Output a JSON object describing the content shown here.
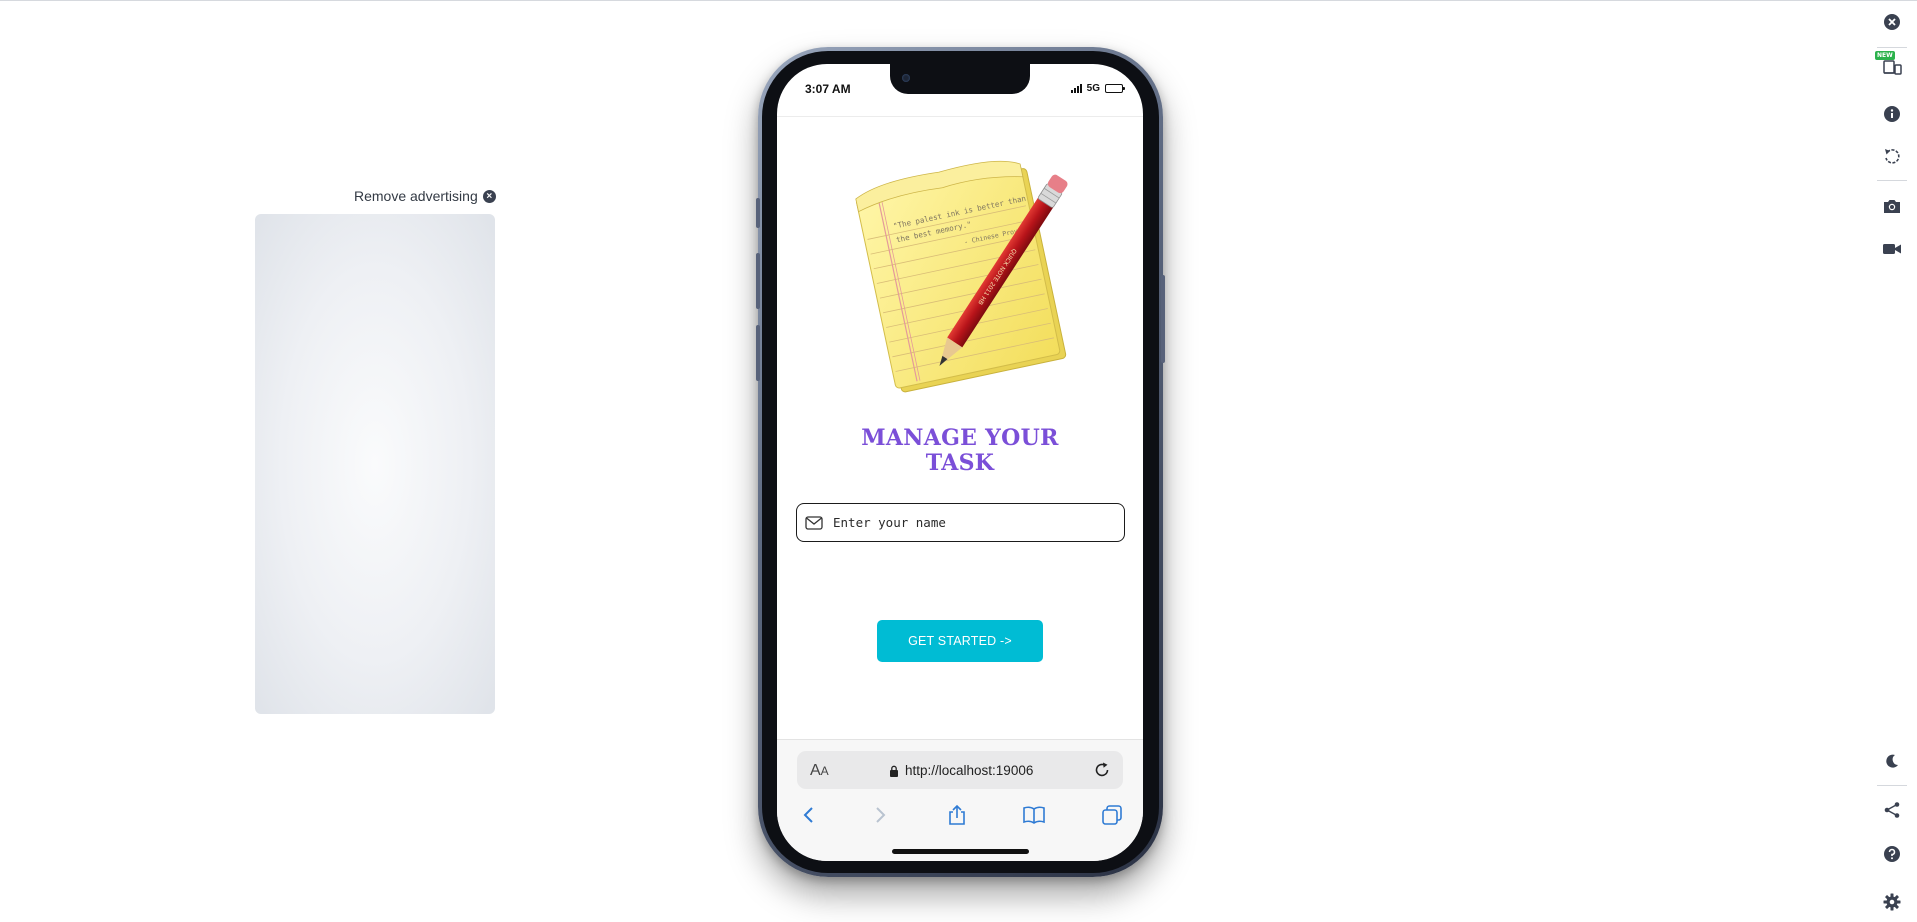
{
  "ad": {
    "remove_label": "Remove advertising"
  },
  "phone": {
    "status": {
      "time": "3:07 AM",
      "network": "5G"
    },
    "app": {
      "title_line1": "MANAGE YOUR",
      "title_line2": "TASK",
      "name_placeholder": "Enter your name",
      "name_value": "",
      "cta_label": "GET STARTED ->",
      "notepad_quote_line1": "\"The palest ink is better than",
      "notepad_quote_line2": "the best memory.\"",
      "notepad_quote_author": "- Chinese Proverb",
      "pencil_text": "QUICK NOTE 2011 HB"
    },
    "browser": {
      "text_size_label": "AA",
      "url": "http://localhost:19006"
    }
  },
  "toolbar": {
    "new_badge": "NEW",
    "items": [
      "close",
      "devices",
      "info",
      "rotate",
      "screenshot",
      "record",
      "dark-mode",
      "share",
      "help",
      "settings"
    ]
  },
  "colors": {
    "title": "#7b4fd8",
    "cta": "#00bcd4",
    "browser_blue": "#2f7bd4"
  }
}
